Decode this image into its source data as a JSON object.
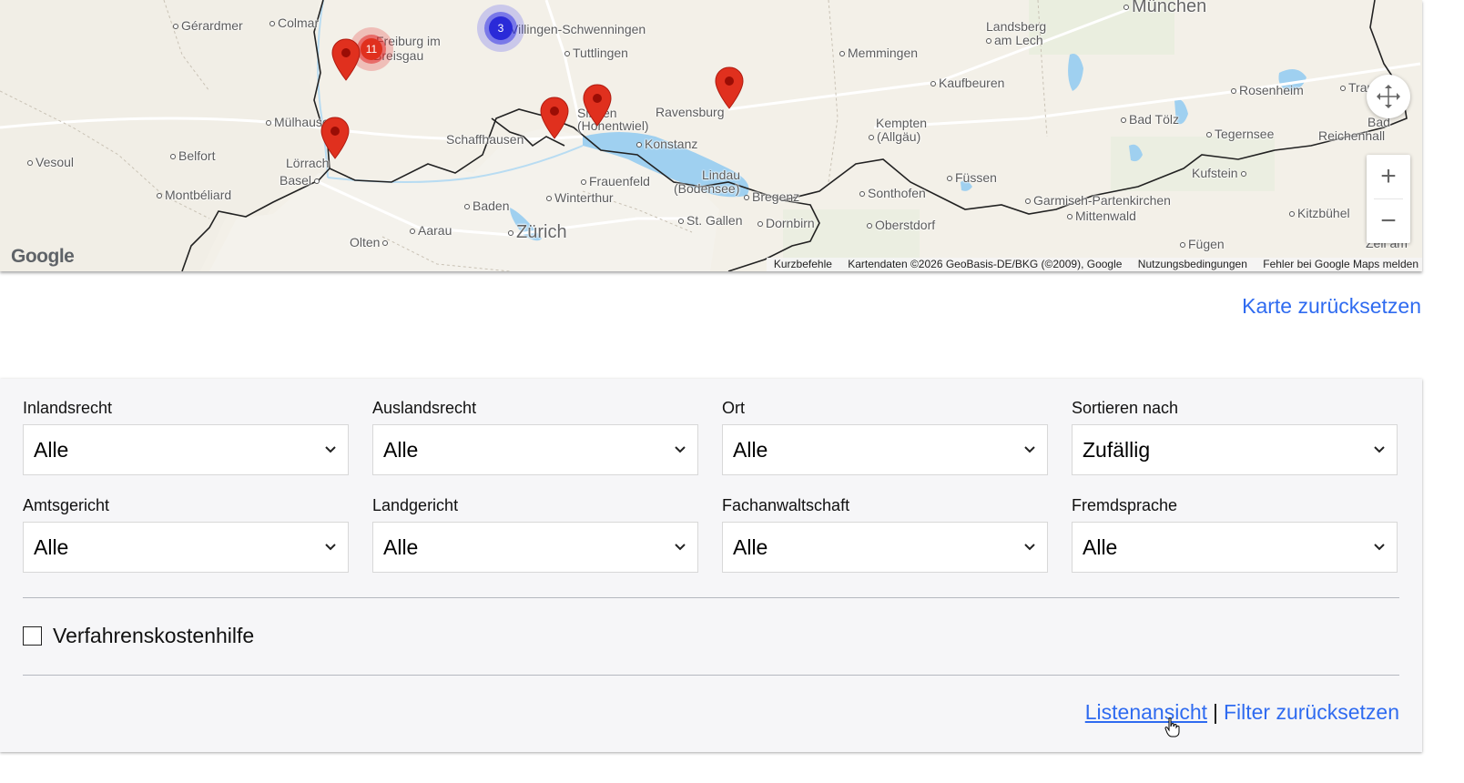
{
  "map": {
    "cities": [
      {
        "name": "Gérardmer",
        "big": false
      },
      {
        "name": "Colmar",
        "big": false
      },
      {
        "name": "Freiburg im",
        "big": false
      },
      {
        "name": "Breisgau",
        "big": false
      },
      {
        "name": "Villingen-Schwenningen",
        "big": false
      },
      {
        "name": "Tuttlingen",
        "big": false
      },
      {
        "name": "Landsberg",
        "big": false
      },
      {
        "name": "am Lech",
        "big": false
      },
      {
        "name": "München",
        "big": true
      },
      {
        "name": "Memmingen",
        "big": false
      },
      {
        "name": "Kaufbeuren",
        "big": false
      },
      {
        "name": "Rosenheim",
        "big": false
      },
      {
        "name": "Trau",
        "big": false
      },
      {
        "name": "Mülhausen",
        "big": false
      },
      {
        "name": "Ravensburg",
        "big": false
      },
      {
        "name": "Singen",
        "big": false
      },
      {
        "name": "(Hohentwiel)",
        "big": false
      },
      {
        "name": "Schaffhausen",
        "big": false
      },
      {
        "name": "Konstanz",
        "big": false
      },
      {
        "name": "Kempten",
        "big": false
      },
      {
        "name": "(Allgäu)",
        "big": false
      },
      {
        "name": "Bad Tölz",
        "big": false
      },
      {
        "name": "Tegernsee",
        "big": false
      },
      {
        "name": "Bad",
        "big": false
      },
      {
        "name": "Reichenhall",
        "big": false
      },
      {
        "name": "Vesoul",
        "big": false
      },
      {
        "name": "Belfort",
        "big": false
      },
      {
        "name": "Lörrach",
        "big": false
      },
      {
        "name": "Basel",
        "big": false
      },
      {
        "name": "Frauenfeld",
        "big": false
      },
      {
        "name": "Lindau",
        "big": false
      },
      {
        "name": "(Bodensee)",
        "big": false
      },
      {
        "name": "Füssen",
        "big": false
      },
      {
        "name": "Kufstein",
        "big": false
      },
      {
        "name": "Montbéliard",
        "big": false
      },
      {
        "name": "Winterthur",
        "big": false
      },
      {
        "name": "Bregenz",
        "big": false
      },
      {
        "name": "Sonthofen",
        "big": false
      },
      {
        "name": "Garmisch-Partenkirchen",
        "big": false
      },
      {
        "name": "Baden",
        "big": false
      },
      {
        "name": "St. Gallen",
        "big": false
      },
      {
        "name": "Dornbirn",
        "big": false
      },
      {
        "name": "Mittenwald",
        "big": false
      },
      {
        "name": "Kitzbühel",
        "big": false
      },
      {
        "name": "Aarau",
        "big": false
      },
      {
        "name": "Zürich",
        "big": true
      },
      {
        "name": "Oberstdorf",
        "big": false
      },
      {
        "name": "Olten",
        "big": false
      },
      {
        "name": "Fügen",
        "big": false
      },
      {
        "name": "Zell am",
        "big": false
      }
    ],
    "cluster_red_count": "11",
    "cluster_blue_count": "3",
    "google_logo": "Google",
    "attribution": {
      "shortcuts": "Kurzbefehle",
      "map_data": "Kartendaten ©2026 GeoBasis-DE/BKG (©2009), Google",
      "terms": "Nutzungsbedingungen",
      "report": "Fehler bei Google Maps melden"
    },
    "zoom_in": "+",
    "zoom_out": "−"
  },
  "reset_map_label": "Karte zurücksetzen",
  "filters": {
    "inlandsrecht": {
      "label": "Inlandsrecht",
      "value": "Alle"
    },
    "auslandsrecht": {
      "label": "Auslandsrecht",
      "value": "Alle"
    },
    "ort": {
      "label": "Ort",
      "value": "Alle"
    },
    "sortieren": {
      "label": "Sortieren nach",
      "value": "Zufällig"
    },
    "amtsgericht": {
      "label": "Amtsgericht",
      "value": "Alle"
    },
    "landgericht": {
      "label": "Landgericht",
      "value": "Alle"
    },
    "fachanwaltschaft": {
      "label": "Fachanwaltschaft",
      "value": "Alle"
    },
    "fremdsprache": {
      "label": "Fremdsprache",
      "value": "Alle"
    }
  },
  "checkbox_vkh": {
    "label": "Verfahrenskostenhilfe",
    "checked": false
  },
  "links": {
    "list_view": "Listenansicht",
    "separator": "|",
    "reset_filters": "Filter zurücksetzen"
  },
  "colors": {
    "link": "#2f6bf0",
    "marker": "#e0301e",
    "cluster_blue": "#2a2ad8",
    "lake": "#9fd0f0",
    "panel_bg": "#f6f6f8"
  }
}
